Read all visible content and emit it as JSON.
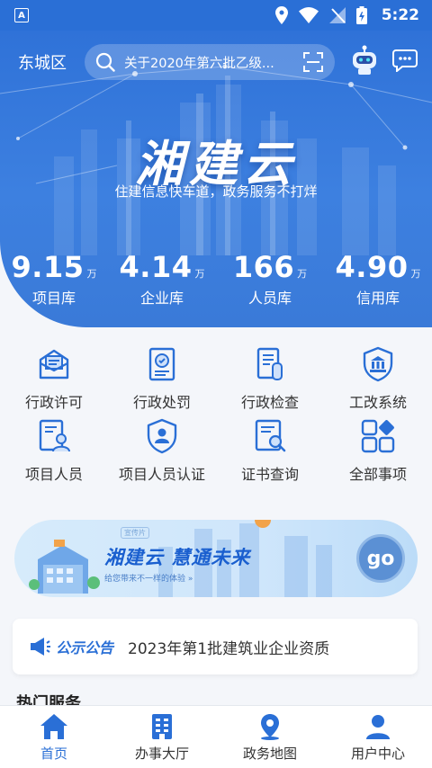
{
  "status_bar": {
    "time": "5:22",
    "app_icon_letter": "A"
  },
  "header": {
    "location": "东城区",
    "search_text": "关于2020年第六批乙级...",
    "icons": [
      "search-icon",
      "scan-icon",
      "robot-assistant-icon",
      "message-icon"
    ]
  },
  "hero": {
    "title": "湘建云",
    "subtitle": "住建信息快车道，政务服务不打烊"
  },
  "stats": [
    {
      "value": "9.15",
      "unit": "万",
      "label": "项目库"
    },
    {
      "value": "4.14",
      "unit": "万",
      "label": "企业库"
    },
    {
      "value": "166",
      "unit": "万",
      "label": "人员库"
    },
    {
      "value": "4.90",
      "unit": "万",
      "label": "信用库"
    }
  ],
  "services": [
    {
      "label": "行政许可",
      "icon": "license-icon"
    },
    {
      "label": "行政处罚",
      "icon": "penalty-icon"
    },
    {
      "label": "行政检查",
      "icon": "inspection-icon"
    },
    {
      "label": "工改系统",
      "icon": "building-shield-icon"
    },
    {
      "label": "项目人员",
      "icon": "project-staff-icon"
    },
    {
      "label": "项目人员认证",
      "icon": "staff-certification-icon"
    },
    {
      "label": "证书查询",
      "icon": "certificate-search-icon"
    },
    {
      "label": "全部事项",
      "icon": "all-items-icon"
    }
  ],
  "banner": {
    "tag": "宣传片",
    "title": "湘建云  慧通未来",
    "subtitle": "给您带来不一样的体验 »",
    "go_label": "go"
  },
  "notice": {
    "tag": "公示公告",
    "text": "2023年第1批建筑业企业资质"
  },
  "next_section_peek": "热门服务",
  "bottom_nav": [
    {
      "label": "首页",
      "icon": "home-icon",
      "active": true
    },
    {
      "label": "办事大厅",
      "icon": "office-building-icon",
      "active": false
    },
    {
      "label": "政务地图",
      "icon": "map-pin-icon",
      "active": false
    },
    {
      "label": "用户中心",
      "icon": "user-icon",
      "active": false
    }
  ],
  "colors": {
    "primary": "#2a6fd6",
    "hero_top": "#2f72d8",
    "text": "#333333",
    "banner_bg": "#d6ebfb"
  }
}
